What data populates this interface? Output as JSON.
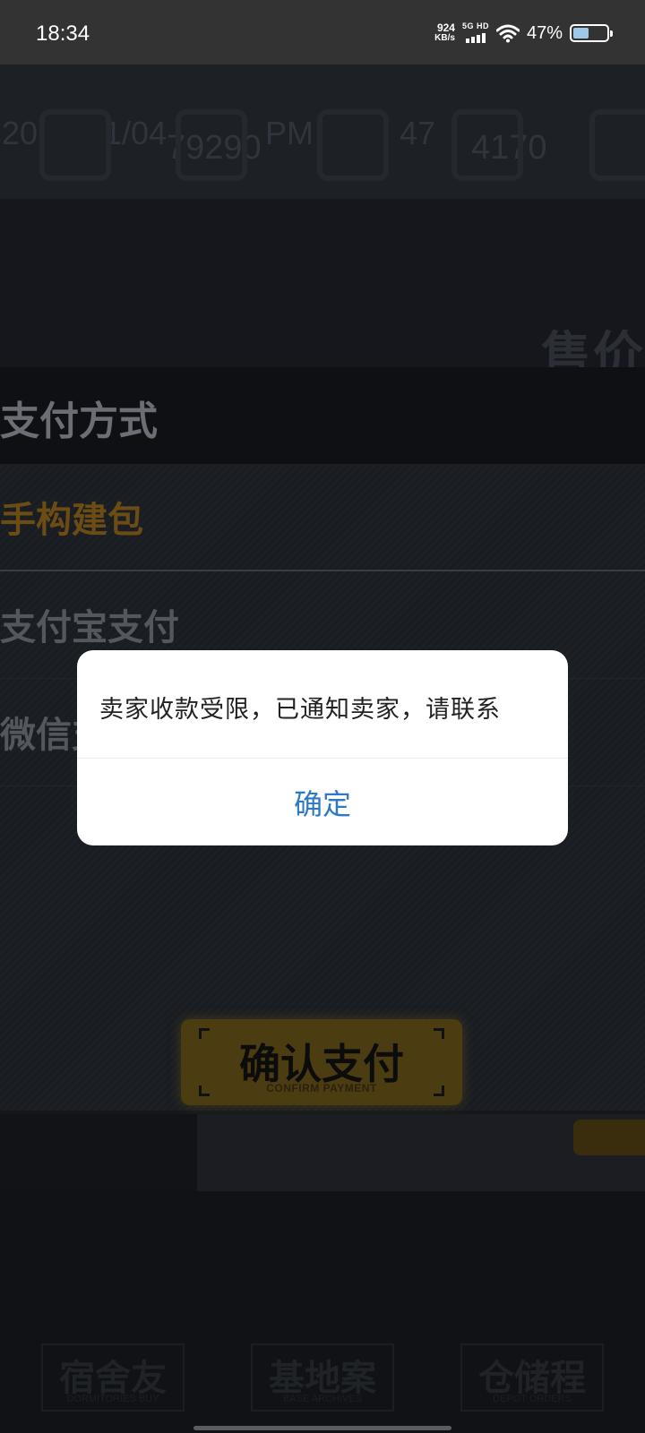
{
  "status_bar": {
    "time": "18:34",
    "net_speed_value": "924",
    "net_speed_unit": "KB/s",
    "signal_label": "5G HD",
    "battery_percent": "47%",
    "battery_level": 0.47
  },
  "background": {
    "top_strip_text_1": "20",
    "top_strip_text_2": "1/04",
    "top_strip_text_3": "79290",
    "top_strip_text_4": "PM",
    "top_strip_text_5": "47",
    "top_strip_text_6": "4170",
    "price_label": "售价",
    "payment_title": "支付方式",
    "payment_options": [
      {
        "label": "手构建包"
      },
      {
        "label": "支付宝支付"
      },
      {
        "label": "微信支"
      }
    ],
    "confirm_button": {
      "label": "确认支付",
      "sub_label": "CONFIRM PAYMENT"
    },
    "bottom_nav": [
      {
        "label": "宿舍友",
        "sub": "DORMITORIES BUY"
      },
      {
        "label": "基地案",
        "sub": "BASE ARCHIVES"
      },
      {
        "label": "仓储程",
        "sub": "DEPOT ORDERS"
      }
    ]
  },
  "dialog": {
    "message": "卖家收款受限，已通知卖家，请联系",
    "ok_label": "确定",
    "ok_color": "#2d79c7"
  }
}
